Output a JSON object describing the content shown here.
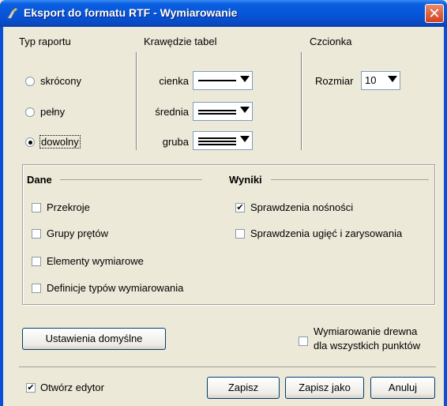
{
  "window": {
    "title": "Eksport do formatu RTF - Wymiarowanie",
    "close": "✕"
  },
  "report_type": {
    "label": "Typ raportu",
    "options": [
      {
        "label": "skrócony",
        "selected": false
      },
      {
        "label": "pełny",
        "selected": false
      },
      {
        "label": "dowolny",
        "selected": true
      }
    ]
  },
  "table_borders": {
    "label": "Krawędzie tabel",
    "rows": [
      {
        "label": "cienka"
      },
      {
        "label": "średnia"
      },
      {
        "label": "gruba"
      }
    ]
  },
  "font": {
    "label": "Czcionka",
    "size_label": "Rozmiar",
    "size_value": "10"
  },
  "data_section": {
    "label": "Dane",
    "items": [
      {
        "label": "Przekroje",
        "checked": false
      },
      {
        "label": "Grupy prętów",
        "checked": false
      },
      {
        "label": "Elementy wymiarowe",
        "checked": false
      },
      {
        "label": "Definicje typów wymiarowania",
        "checked": false
      }
    ]
  },
  "results_section": {
    "label": "Wyniki",
    "items": [
      {
        "label": "Sprawdzenia nośności",
        "checked": true
      },
      {
        "label": "Sprawdzenia ugięć i zarysowania",
        "checked": false
      }
    ]
  },
  "defaults_button": "Ustawienia domyślne",
  "wood_option": {
    "line1": "Wymiarowanie drewna",
    "line2": "dla wszystkich punktów",
    "checked": false
  },
  "open_editor": {
    "label": "Otwórz edytor",
    "checked": true
  },
  "buttons": {
    "save": "Zapisz",
    "save_as": "Zapisz jako",
    "cancel": "Anuluj"
  },
  "check_mark": "✔"
}
